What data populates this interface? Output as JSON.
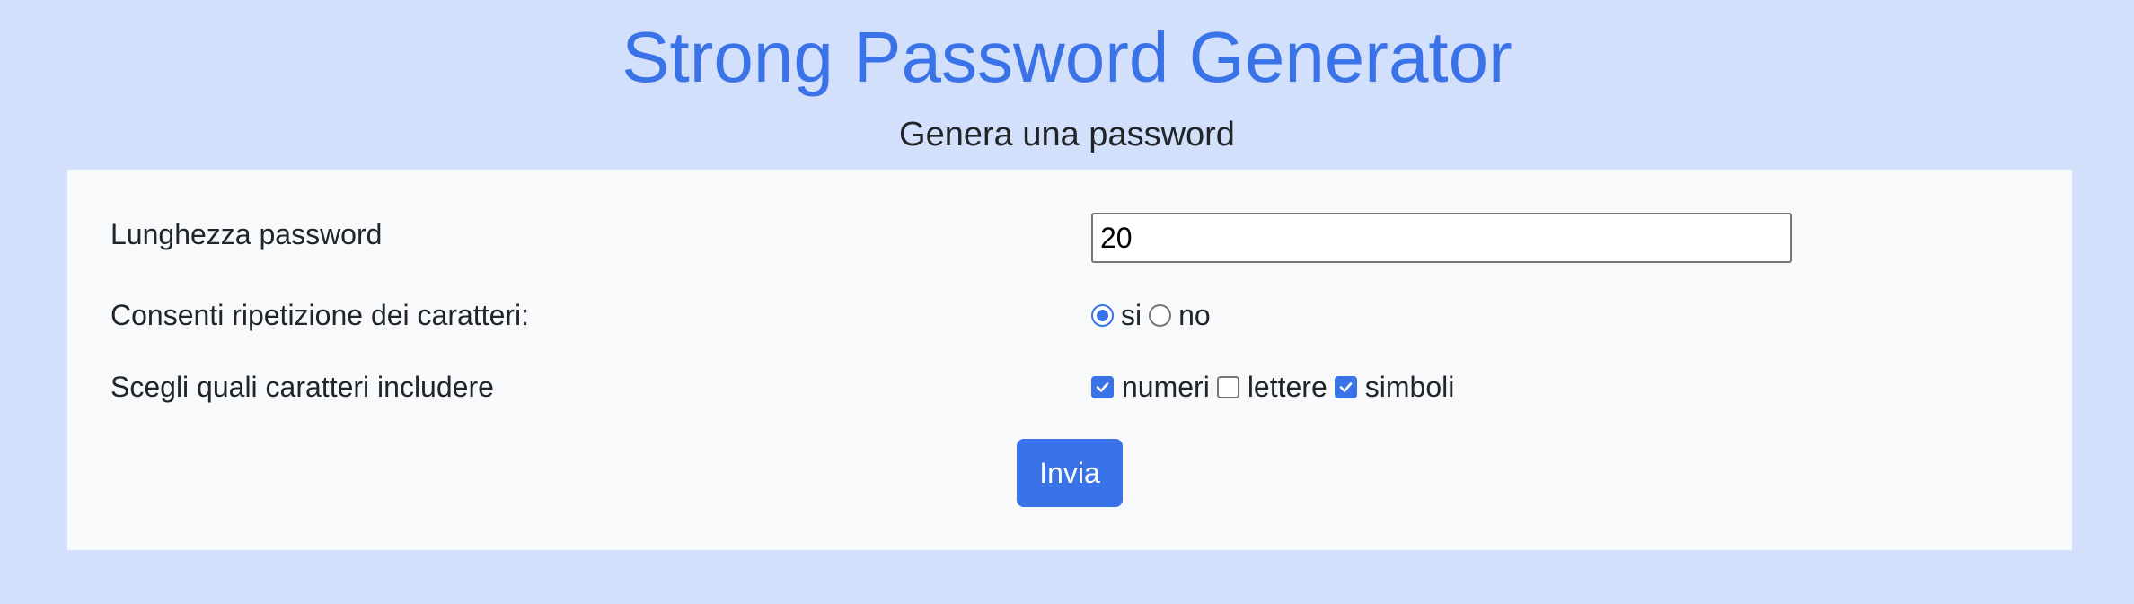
{
  "header": {
    "title": "Strong Password Generator",
    "subtitle": "Genera una password"
  },
  "form": {
    "length": {
      "label": "Lunghezza password",
      "value": "20"
    },
    "repetition": {
      "label": "Consenti ripetizione dei caratteri:",
      "options": [
        {
          "label": "si",
          "checked": true
        },
        {
          "label": "no",
          "checked": false
        }
      ]
    },
    "charsets": {
      "label": "Scegli quali caratteri includere",
      "options": [
        {
          "label": "numeri",
          "checked": true
        },
        {
          "label": "lettere",
          "checked": false
        },
        {
          "label": "simboli",
          "checked": true
        }
      ]
    },
    "submit_label": "Invia"
  },
  "colors": {
    "page_background": "#d3e0fb",
    "card_background": "#f7f9fb",
    "accent": "#3a72e8",
    "text": "#212529"
  }
}
